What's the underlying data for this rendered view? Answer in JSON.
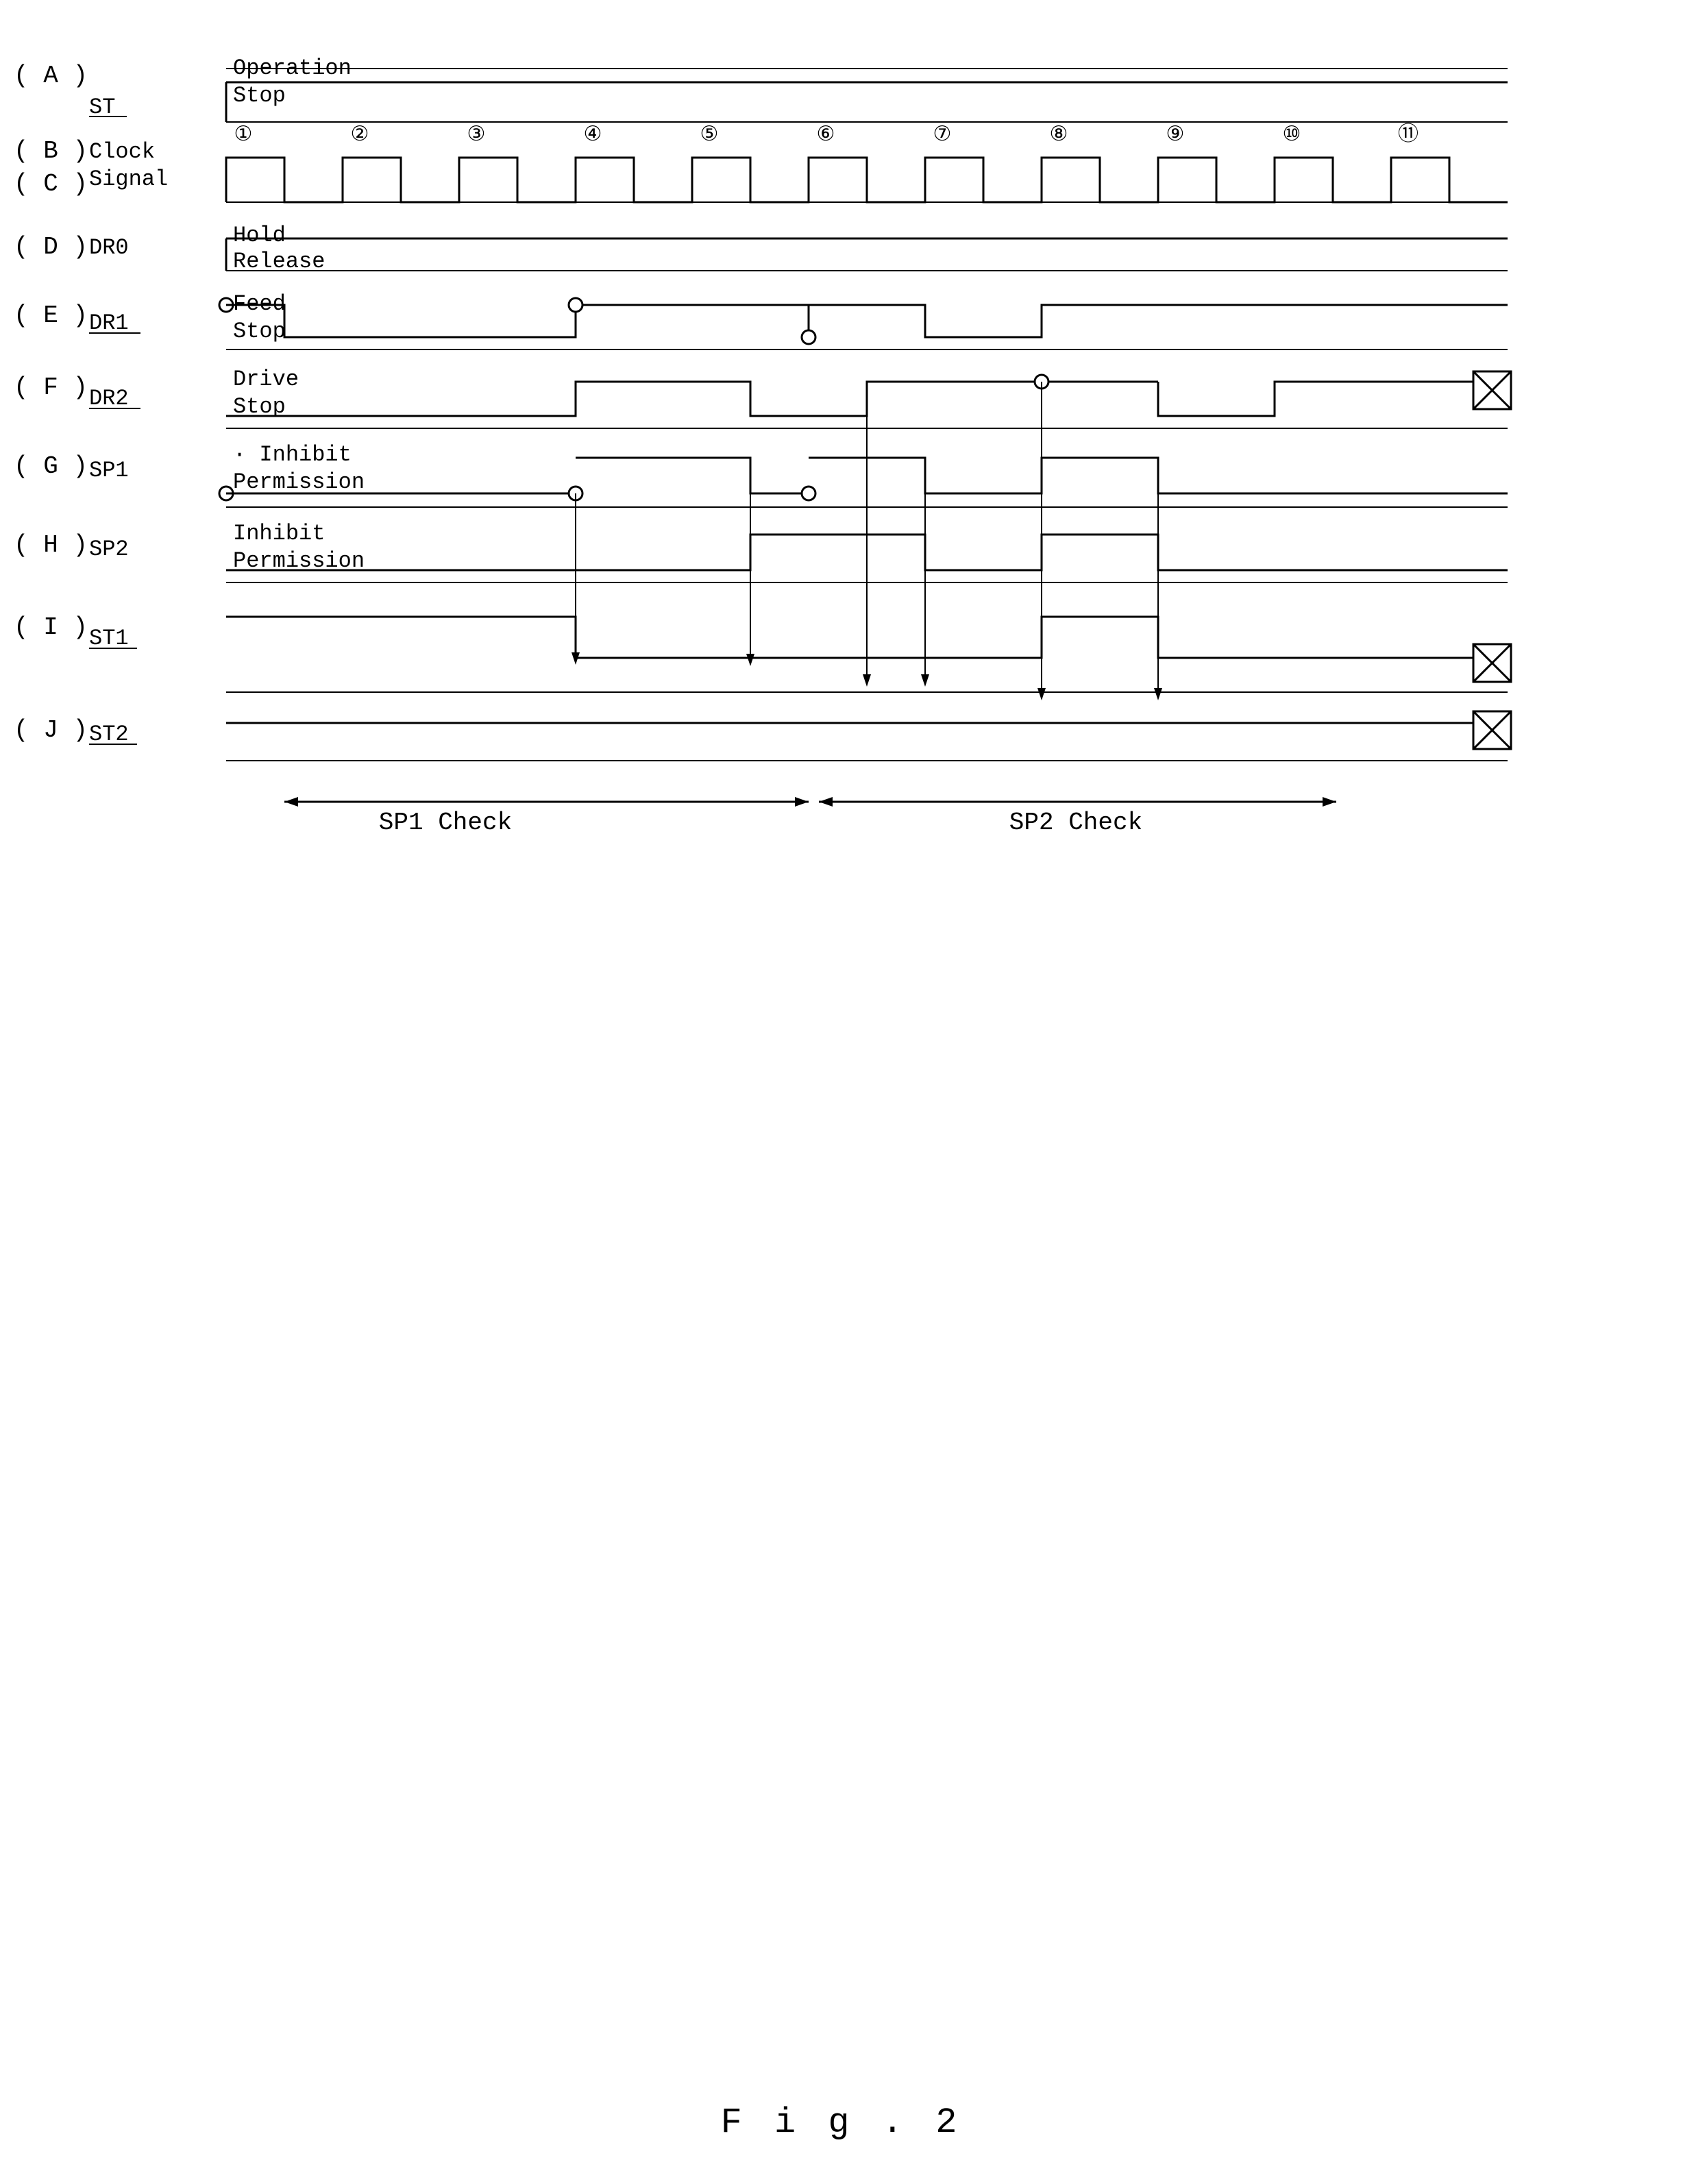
{
  "title": "Fig. 2",
  "diagram": {
    "rows": [
      {
        "id": "A",
        "label": "( A )",
        "signal": "ST",
        "states": [
          "Operation",
          "Stop"
        ]
      },
      {
        "id": "BC",
        "label": "( B )\n( C )",
        "signal": "Clock\nSignal",
        "states": []
      },
      {
        "id": "D",
        "label": "( D )",
        "signal": "DR0",
        "states": [
          "Hold",
          "Release"
        ]
      },
      {
        "id": "E",
        "label": "( E )",
        "signal": "DR1",
        "states": [
          "Feed",
          "Stop"
        ]
      },
      {
        "id": "F",
        "label": "( F )",
        "signal": "DR2",
        "states": [
          "Drive",
          "Stop"
        ]
      },
      {
        "id": "G",
        "label": "( G )",
        "signal": "SP1",
        "states": [
          "Inhibit",
          "Permission"
        ]
      },
      {
        "id": "H",
        "label": "( H )",
        "signal": "SP2",
        "states": [
          "Inhibit",
          "Permission"
        ]
      },
      {
        "id": "I",
        "label": "( I )",
        "signal": "ST1",
        "states": []
      },
      {
        "id": "J",
        "label": "( J )",
        "signal": "ST2",
        "states": []
      }
    ],
    "clocks": [
      "①",
      "②",
      "③",
      "④",
      "⑤",
      "⑥",
      "⑦",
      "⑧",
      "⑨",
      "⑩",
      "⑪"
    ],
    "check_labels": [
      "SP1 Check",
      "SP2 Check"
    ],
    "fig_label": "F i g .  2"
  }
}
